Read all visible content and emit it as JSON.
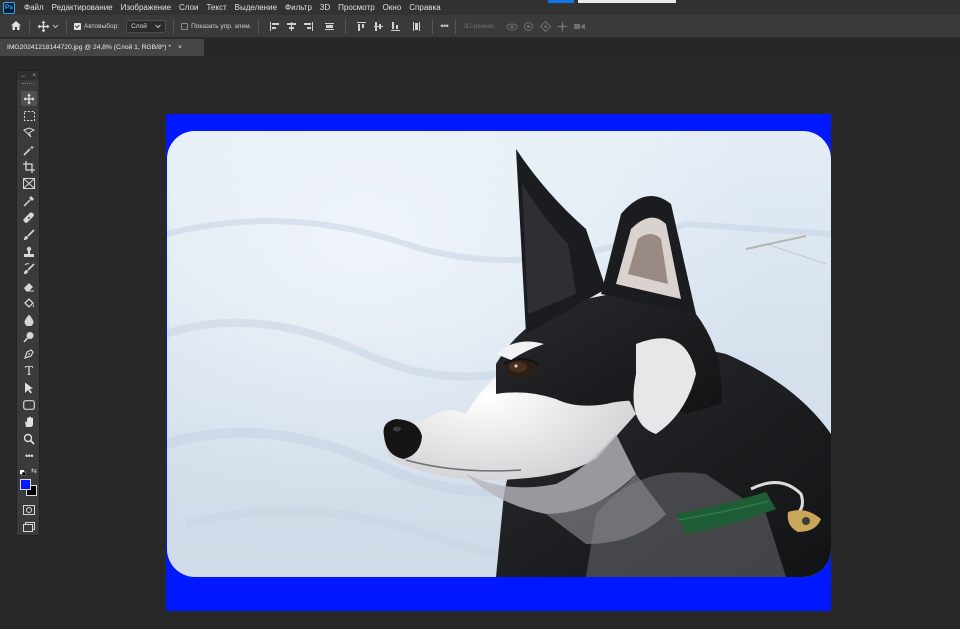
{
  "app": {
    "logo": "Ps"
  },
  "menu": [
    "Файл",
    "Редактирование",
    "Изображение",
    "Слои",
    "Текст",
    "Выделение",
    "Фильтр",
    "3D",
    "Просмотр",
    "Окно",
    "Справка"
  ],
  "options": {
    "auto_select_label": "Автовыбор:",
    "auto_select_checked": true,
    "auto_select_target": "Слой",
    "show_transform_label": "Показать упр. элем.",
    "show_transform_checked": false,
    "more_label": "•••",
    "mode_3d_label": "3D-режим:"
  },
  "document_tab": {
    "title": "IMG20241218144720.jpg @ 24,8% (Слой 1, RGB/8*) *",
    "close": "×"
  },
  "toolbar": {
    "header_left": "↔",
    "header_right": "×",
    "tools": [
      "move-tool",
      "marquee-tool",
      "lasso-tool",
      "magic-wand-tool",
      "crop-tool",
      "frame-tool",
      "eyedropper-tool",
      "healing-brush-tool",
      "brush-tool",
      "clone-stamp-tool",
      "history-brush-tool",
      "eraser-tool",
      "paint-bucket-tool",
      "blur-tool",
      "dodge-tool",
      "pen-tool",
      "type-tool",
      "path-selection-tool",
      "rectangle-tool",
      "hand-tool",
      "zoom-tool",
      "edit-toolbar-button"
    ],
    "type_tool_glyph": "T",
    "more_glyph": "•••",
    "foreground_color": "#0019ff",
    "background_color": "#000000",
    "swap_glyph": "⇆"
  },
  "canvas": {
    "frame_color": "#0018ff",
    "subject": "husky-dog-photo"
  }
}
